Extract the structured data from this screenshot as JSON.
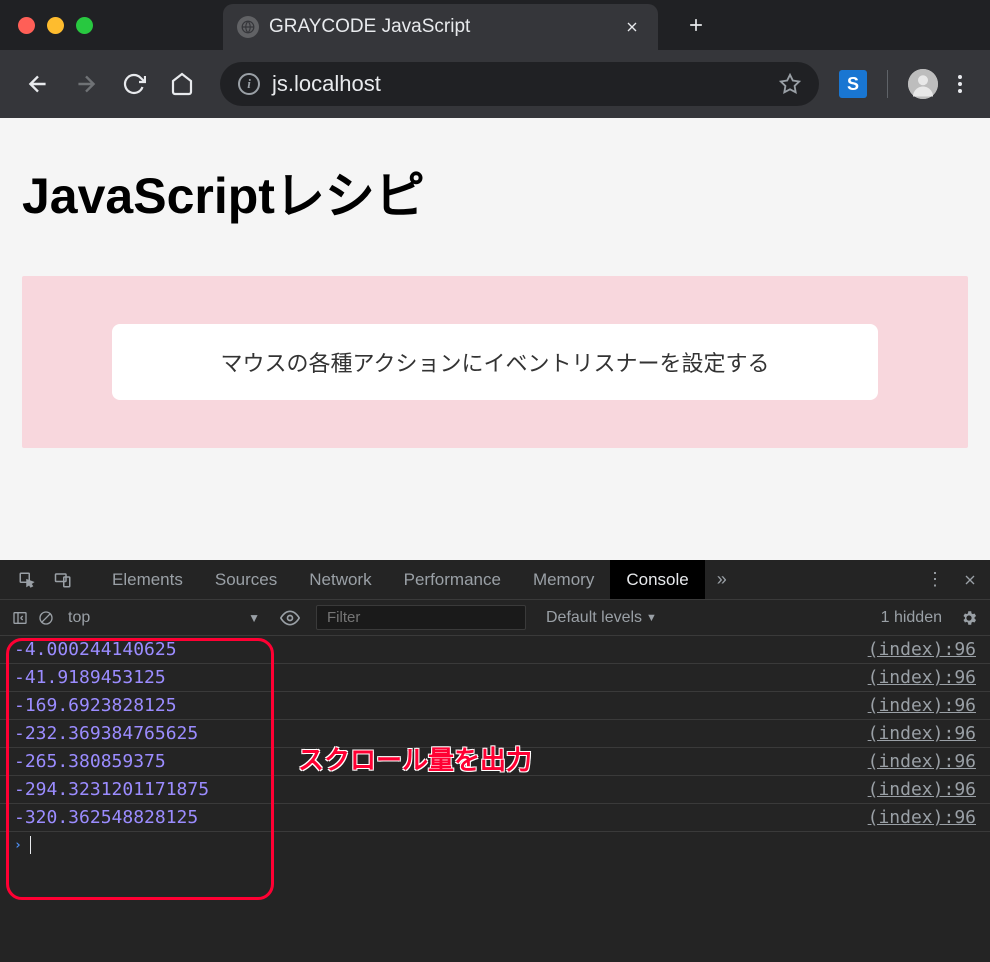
{
  "browser": {
    "tab_title": "GRAYCODE JavaScript",
    "url": "js.localhost",
    "extension_letter": "S"
  },
  "page": {
    "heading": "JavaScriptレシピ",
    "button_text": "マウスの各種アクションにイベントリスナーを設定する"
  },
  "devtools": {
    "tabs": [
      "Elements",
      "Sources",
      "Network",
      "Performance",
      "Memory",
      "Console"
    ],
    "more_label": "»",
    "context": "top",
    "filter_placeholder": "Filter",
    "levels_label": "Default levels",
    "hidden_label": "1 hidden",
    "console": [
      {
        "value": "-4.000244140625",
        "source": "(index):96"
      },
      {
        "value": "-41.9189453125",
        "source": "(index):96"
      },
      {
        "value": "-169.6923828125",
        "source": "(index):96"
      },
      {
        "value": "-232.369384765625",
        "source": "(index):96"
      },
      {
        "value": "-265.380859375",
        "source": "(index):96"
      },
      {
        "value": "-294.3231201171875",
        "source": "(index):96"
      },
      {
        "value": "-320.362548828125",
        "source": "(index):96"
      }
    ]
  },
  "annotation": "スクロール量を出力"
}
